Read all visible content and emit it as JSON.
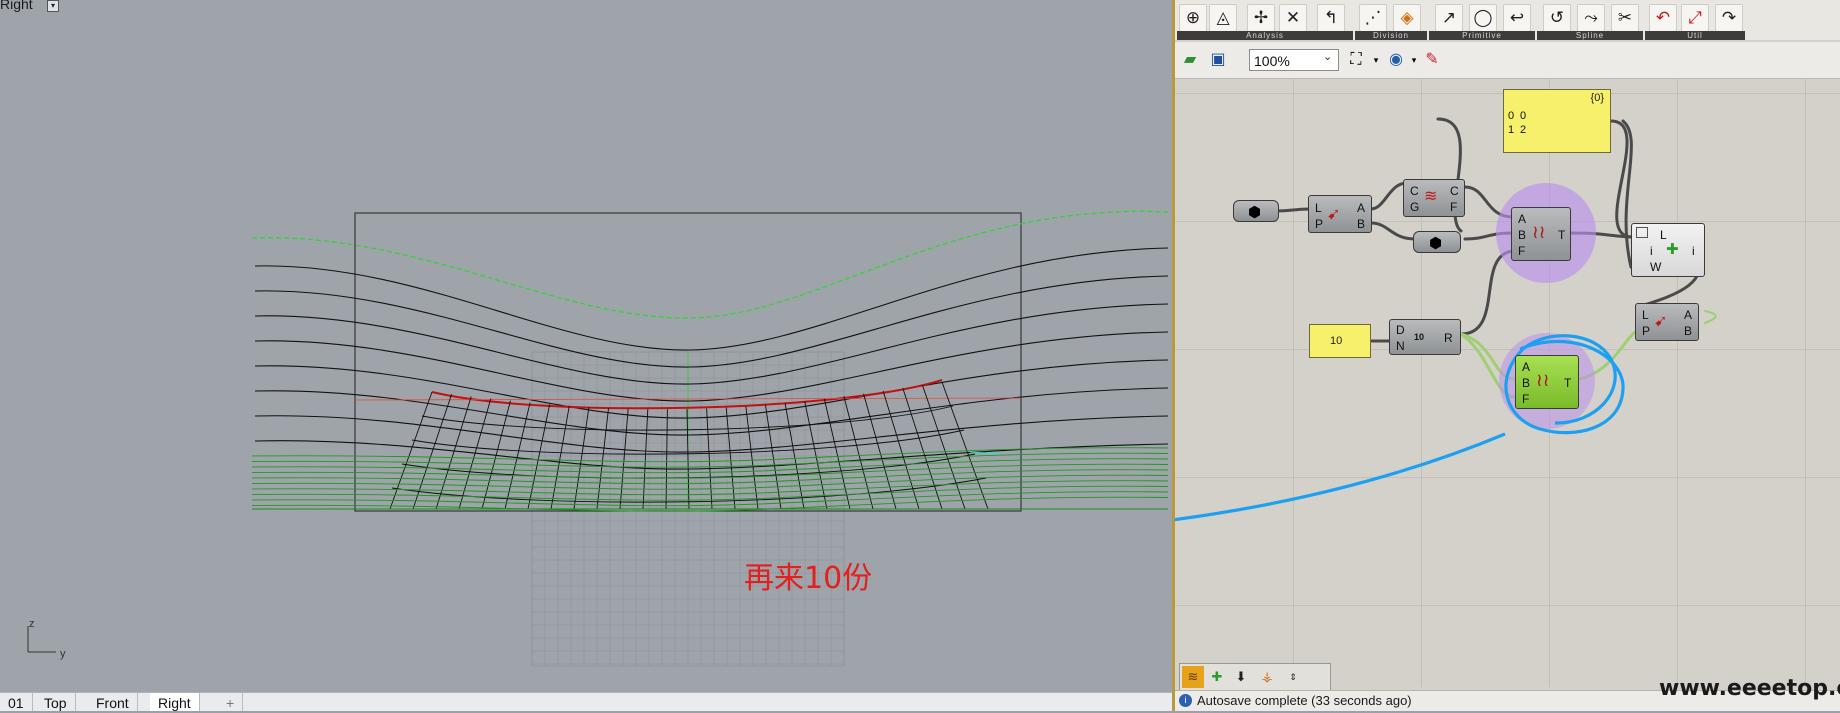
{
  "viewport": {
    "label": "Right",
    "label_menu": "▾",
    "annotation": "再来10份",
    "axis_z": "z",
    "axis_y": "y",
    "tabs": [
      "01",
      "Top",
      "Front",
      "Right",
      "+"
    ]
  },
  "ribbon": {
    "groups": [
      {
        "label": "Analysis",
        "icons": [
          "⊕",
          "◬",
          "✢",
          "✕",
          "↰"
        ]
      },
      {
        "label": "Division",
        "icons": [
          "⋰",
          "◈"
        ]
      },
      {
        "label": "Primitive",
        "icons": [
          "↗",
          "◯",
          "↩"
        ]
      },
      {
        "label": "Spline",
        "icons": [
          "↺",
          "⤳",
          "✂"
        ]
      },
      {
        "label": "Util",
        "icons": [
          "↶",
          "⤢",
          "↷"
        ]
      }
    ]
  },
  "toolbar": {
    "zoom": "100%",
    "zoom_chevron": "⌄"
  },
  "canvas": {
    "panel_top": {
      "header": "{0}",
      "rows": [
        {
          "index": "0",
          "value": "0"
        },
        {
          "index": "1",
          "value": "2"
        }
      ]
    },
    "slider_value": "10",
    "comp_la": {
      "inputs": [
        "L",
        "P"
      ],
      "outputs": [
        "A",
        "B"
      ]
    },
    "comp_cg": {
      "inputs": [
        "C",
        "G"
      ],
      "outputs": [
        "C",
        "F"
      ]
    },
    "comp_abf_top": {
      "inputs": [
        "A",
        "B",
        "F"
      ],
      "outputs": [
        "T"
      ]
    },
    "comp_lw": {
      "inputs": [
        "L",
        "i",
        "W"
      ],
      "outputs": [
        "i"
      ]
    },
    "comp_dn": {
      "inputs": [
        "D",
        "N"
      ],
      "outputs": [
        "R"
      ],
      "glyph": "10"
    },
    "comp_lp2": {
      "inputs": [
        "L",
        "P"
      ],
      "outputs": [
        "A",
        "B"
      ]
    },
    "comp_abf_green": {
      "inputs": [
        "A",
        "B",
        "F"
      ],
      "outputs": [
        "T"
      ]
    }
  },
  "status": {
    "text": "Autosave complete (33 seconds ago)"
  },
  "watermark": "www.eeeetop.com",
  "colors": {
    "halo": "#b991eb",
    "blue_annotation": "#1ea0f0",
    "panel_yellow": "#f6f06a",
    "green_component": "#8fd13f",
    "red_text": "#e2201d"
  }
}
